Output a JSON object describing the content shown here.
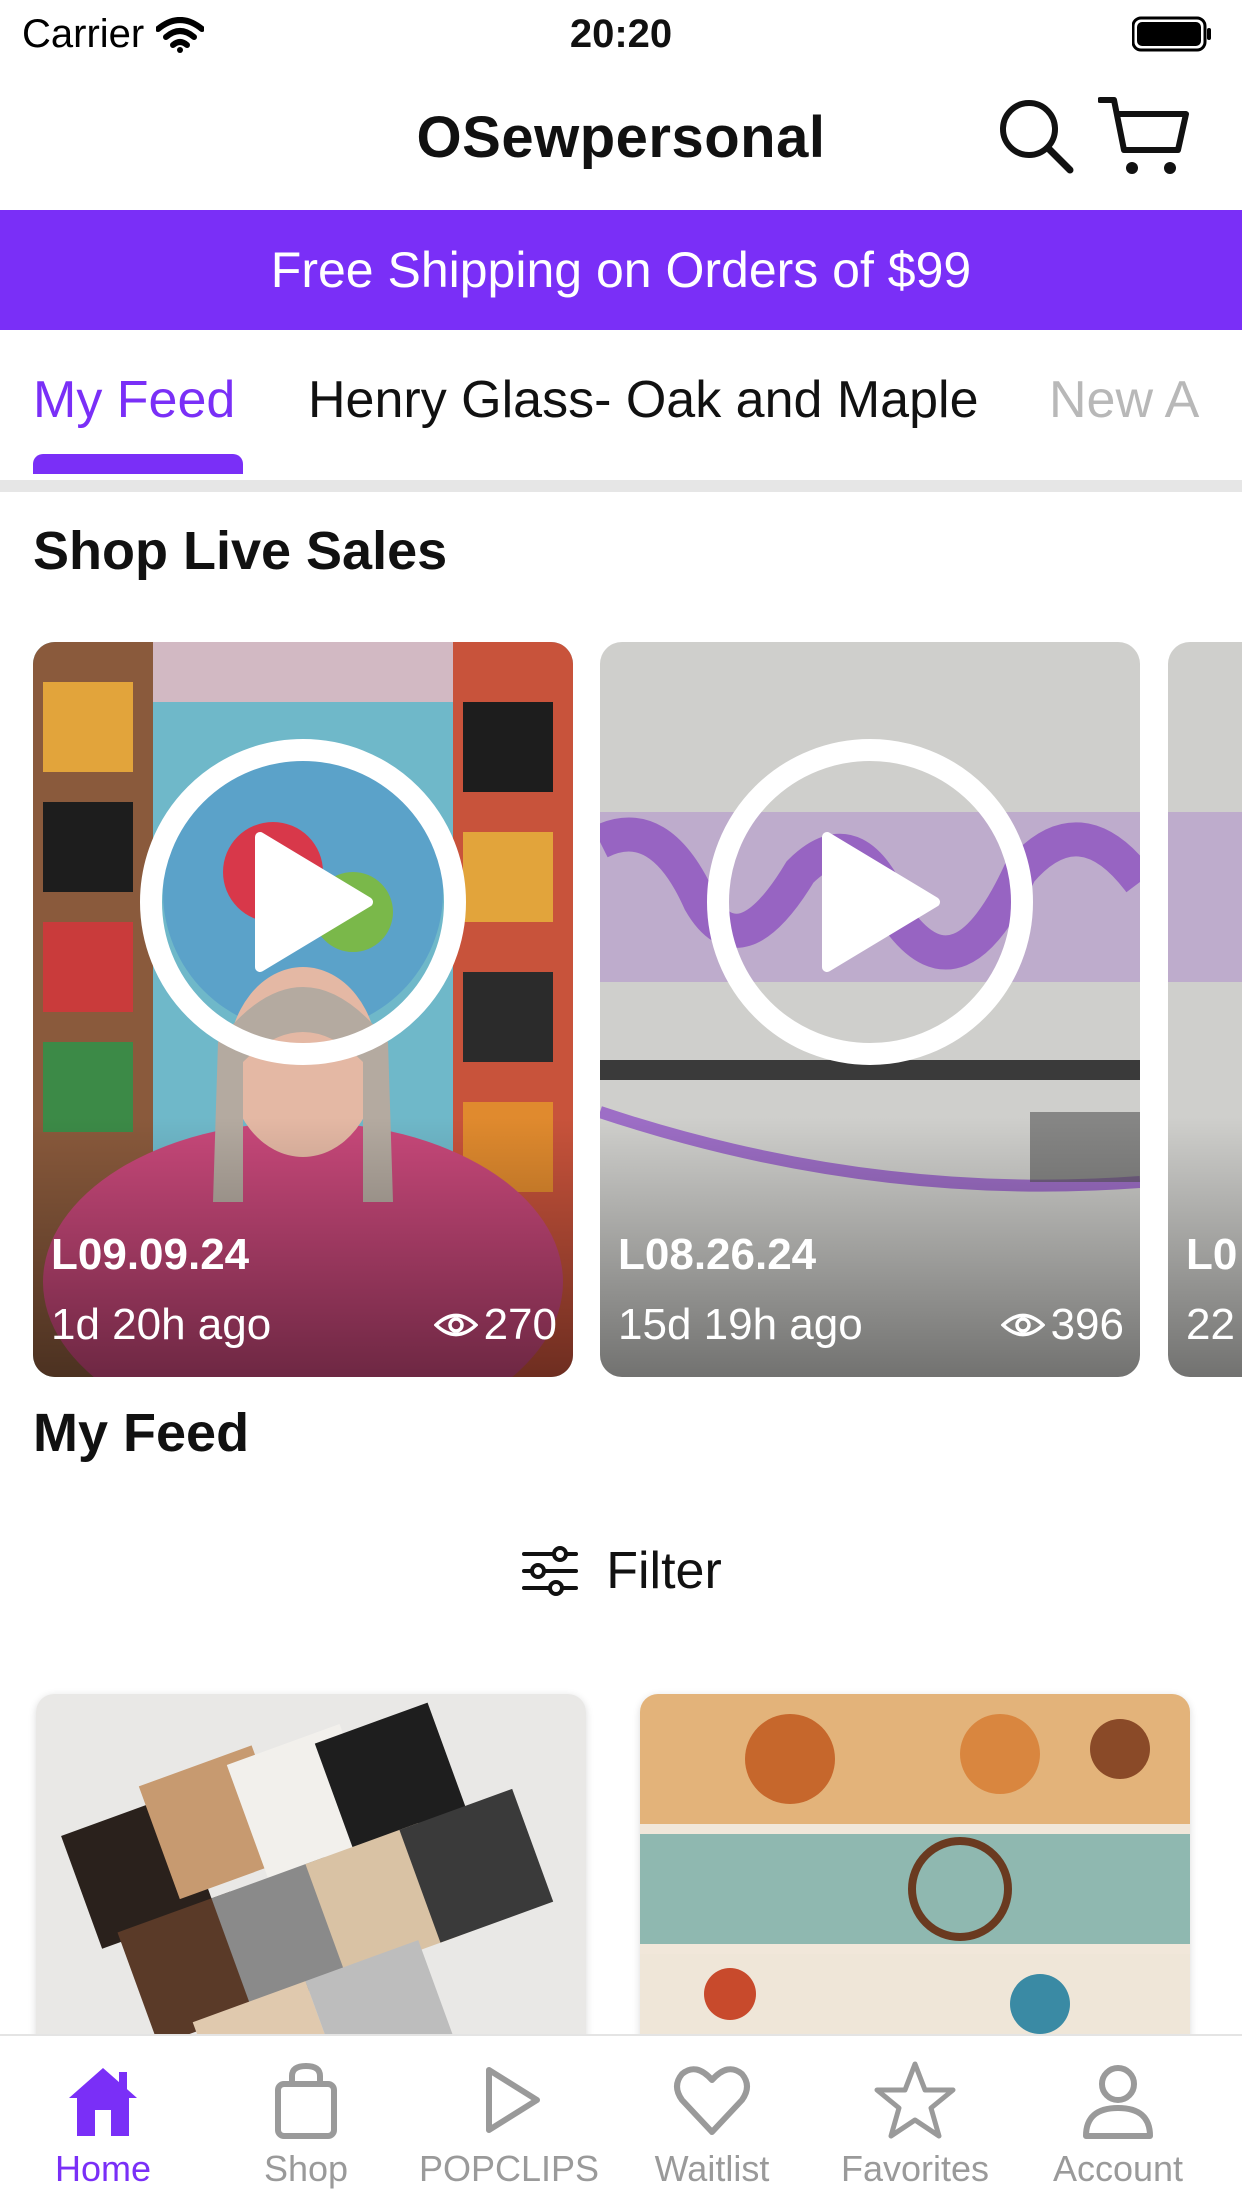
{
  "status_bar": {
    "carrier": "Carrier",
    "time": "20:20"
  },
  "header": {
    "title": "OSewpersonal"
  },
  "promo": {
    "text": "Free Shipping on Orders of $99"
  },
  "tabs": [
    {
      "label": "My Feed"
    },
    {
      "label": "Henry Glass- Oak and Maple"
    },
    {
      "label": "New A"
    }
  ],
  "live_sales": {
    "title": "Shop Live Sales",
    "cards": [
      {
        "code": "L09.09.24",
        "ago": "1d 20h ago",
        "views": "270"
      },
      {
        "code": "L08.26.24",
        "ago": "15d 19h ago",
        "views": "396"
      },
      {
        "code": "L0",
        "ago": "22"
      }
    ]
  },
  "feed": {
    "title": "My Feed",
    "filter_label": "Filter"
  },
  "bottom_nav": [
    {
      "label": "Home",
      "icon": "home-icon"
    },
    {
      "label": "Shop",
      "icon": "shopping-bag-icon"
    },
    {
      "label": "POPCLIPS",
      "icon": "play-icon"
    },
    {
      "label": "Waitlist",
      "icon": "heart-icon"
    },
    {
      "label": "Favorites",
      "icon": "star-icon"
    },
    {
      "label": "Account",
      "icon": "person-icon"
    }
  ],
  "colors": {
    "accent": "#7a2ff7",
    "inactive": "#9a9a9a"
  }
}
